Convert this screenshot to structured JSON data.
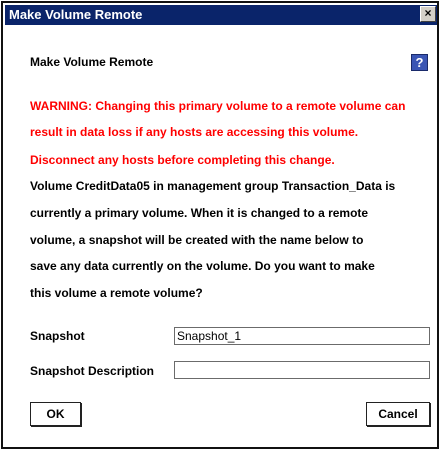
{
  "window": {
    "title": "Make Volume Remote",
    "close_glyph": "×"
  },
  "dialog": {
    "heading": "Make Volume Remote",
    "help_glyph": "?",
    "warning_lines": [
      "WARNING: Changing this primary volume to a remote volume can",
      "result in data loss if any hosts are accessing this volume.",
      "Disconnect any hosts before completing this change."
    ],
    "info_lines": [
      "Volume CreditData05 in management group Transaction_Data is",
      "currently a primary volume. When it is changed to a remote",
      "volume, a snapshot will be created with the name below to",
      "save any data currently on the volume. Do you want to make",
      "this volume a remote volume?"
    ]
  },
  "form": {
    "snapshot_label": "Snapshot",
    "snapshot_value": "Snapshot_1",
    "description_label": "Snapshot Description",
    "description_value": ""
  },
  "buttons": {
    "ok": "OK",
    "cancel": "Cancel"
  },
  "colors": {
    "title_bar": "#0a246a",
    "warning_text": "#ff0000",
    "help_button": "#3a55b4"
  },
  "icons": {
    "close": "close-icon",
    "help": "help-icon"
  }
}
